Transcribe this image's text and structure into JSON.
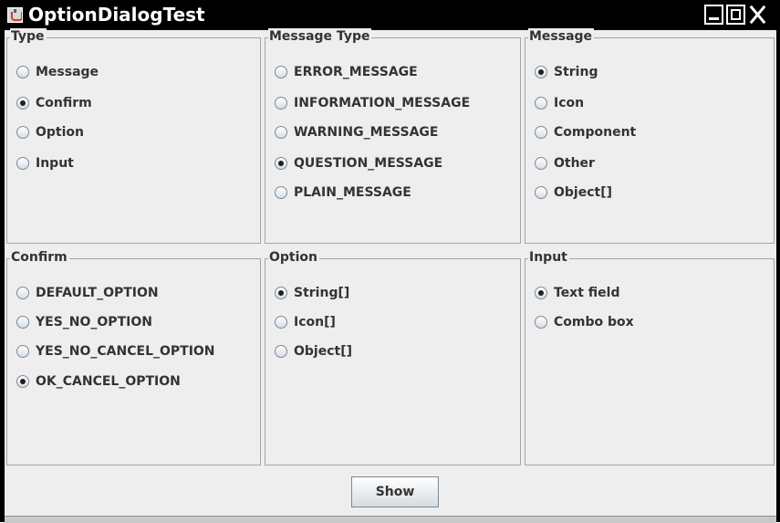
{
  "window": {
    "title": "OptionDialogTest"
  },
  "panels": {
    "type": {
      "legend": "Type",
      "options": [
        "Message",
        "Confirm",
        "Option",
        "Input"
      ],
      "selected": 1
    },
    "message_type": {
      "legend": "Message Type",
      "options": [
        "ERROR_MESSAGE",
        "INFORMATION_MESSAGE",
        "WARNING_MESSAGE",
        "QUESTION_MESSAGE",
        "PLAIN_MESSAGE"
      ],
      "selected": 3
    },
    "message": {
      "legend": "Message",
      "options": [
        "String",
        "Icon",
        "Component",
        "Other",
        "Object[]"
      ],
      "selected": 0
    },
    "confirm": {
      "legend": "Confirm",
      "options": [
        "DEFAULT_OPTION",
        "YES_NO_OPTION",
        "YES_NO_CANCEL_OPTION",
        "OK_CANCEL_OPTION"
      ],
      "selected": 3
    },
    "option": {
      "legend": "Option",
      "options": [
        "String[]",
        "Icon[]",
        "Object[]"
      ],
      "selected": 0
    },
    "input": {
      "legend": "Input",
      "options": [
        "Text field",
        "Combo box"
      ],
      "selected": 0
    }
  },
  "show_button": {
    "label": "Show"
  }
}
